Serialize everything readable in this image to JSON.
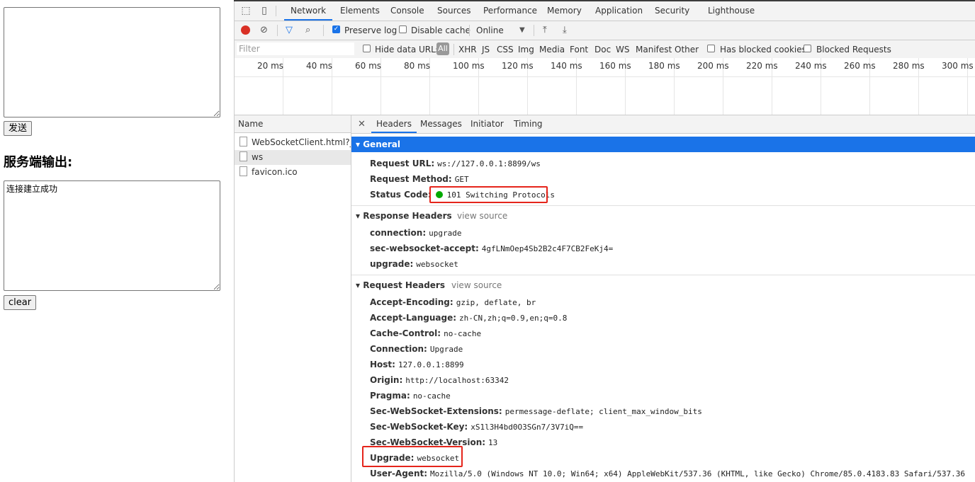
{
  "page": {
    "send_label": "发送",
    "output_heading": "服务端输出:",
    "output_text": "连接建立成功",
    "clear_label": "clear"
  },
  "devtools": {
    "tabs": [
      "Network",
      "Elements",
      "Console",
      "Sources",
      "Performance",
      "Memory",
      "Application",
      "Security",
      "Lighthouse"
    ],
    "active_tab": "Network",
    "toolbar": {
      "preserve_log": "Preserve log",
      "disable_cache": "Disable cache",
      "throttle": "Online",
      "preserve_log_checked": true,
      "disable_cache_checked": false
    },
    "filter": {
      "placeholder": "Filter",
      "hide_data_urls": "Hide data URLs",
      "all": "All",
      "types": [
        "XHR",
        "JS",
        "CSS",
        "Img",
        "Media",
        "Font",
        "Doc",
        "WS",
        "Manifest",
        "Other"
      ],
      "has_blocked_cookies": "Has blocked cookies",
      "blocked_requests": "Blocked Requests"
    },
    "timeline_ticks": [
      "20 ms",
      "40 ms",
      "60 ms",
      "80 ms",
      "100 ms",
      "120 ms",
      "140 ms",
      "160 ms",
      "180 ms",
      "200 ms",
      "220 ms",
      "240 ms",
      "260 ms",
      "280 ms",
      "300 ms"
    ],
    "name_header": "Name",
    "requests": [
      "WebSocketClient.html?_...",
      "ws",
      "favicon.ico"
    ],
    "selected_request": "ws",
    "detail_tabs": [
      "Headers",
      "Messages",
      "Initiator",
      "Timing"
    ],
    "general": {
      "title": "General",
      "rows": [
        {
          "k": "Request URL:",
          "v": "ws://127.0.0.1:8899/ws"
        },
        {
          "k": "Request Method:",
          "v": "GET"
        },
        {
          "k": "Status Code:",
          "v": "101 Switching Protocols"
        }
      ]
    },
    "response_headers": {
      "title": "Response Headers",
      "view_source": "view source",
      "rows": [
        {
          "k": "connection:",
          "v": "upgrade"
        },
        {
          "k": "sec-websocket-accept:",
          "v": "4gfLNmOep4Sb2B2c4F7CB2FeKj4="
        },
        {
          "k": "upgrade:",
          "v": "websocket"
        }
      ]
    },
    "request_headers": {
      "title": "Request Headers",
      "view_source": "view source",
      "rows": [
        {
          "k": "Accept-Encoding:",
          "v": "gzip, deflate, br"
        },
        {
          "k": "Accept-Language:",
          "v": "zh-CN,zh;q=0.9,en;q=0.8"
        },
        {
          "k": "Cache-Control:",
          "v": "no-cache"
        },
        {
          "k": "Connection:",
          "v": "Upgrade"
        },
        {
          "k": "Host:",
          "v": "127.0.0.1:8899"
        },
        {
          "k": "Origin:",
          "v": "http://localhost:63342"
        },
        {
          "k": "Pragma:",
          "v": "no-cache"
        },
        {
          "k": "Sec-WebSocket-Extensions:",
          "v": "permessage-deflate; client_max_window_bits"
        },
        {
          "k": "Sec-WebSocket-Key:",
          "v": "xS1l3H4bd0O3SGn7/3V7iQ=="
        },
        {
          "k": "Sec-WebSocket-Version:",
          "v": "13"
        },
        {
          "k": "Upgrade:",
          "v": "websocket"
        },
        {
          "k": "User-Agent:",
          "v": "Mozilla/5.0 (Windows NT 10.0; Win64; x64) AppleWebKit/537.36 (KHTML, like Gecko) Chrome/85.0.4183.83 Safari/537.36"
        }
      ]
    }
  },
  "colors": {
    "accent": "#1a73e8",
    "record": "#d93025",
    "highlight": "#e5251b",
    "status_ok": "#00aa00"
  }
}
